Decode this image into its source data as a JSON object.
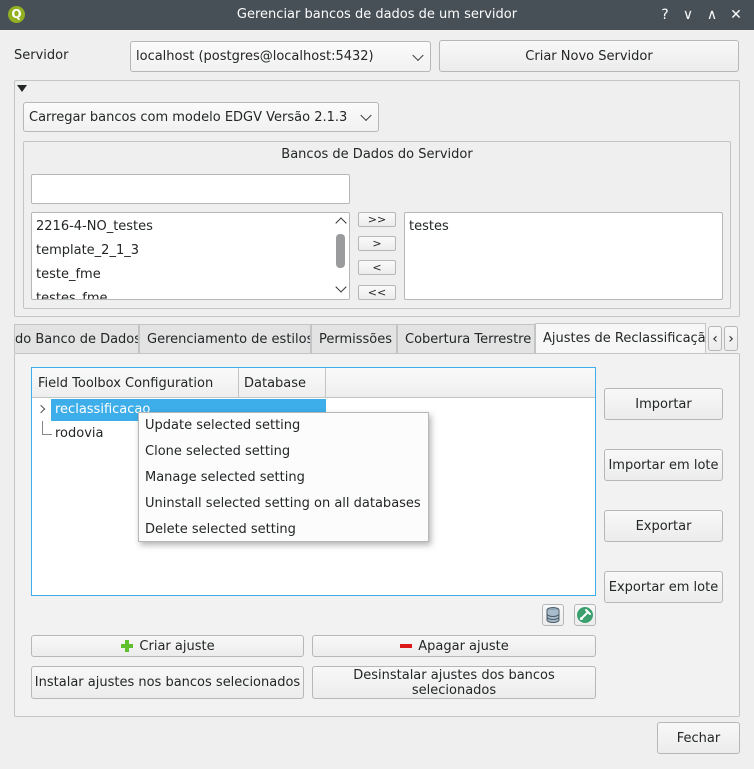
{
  "window": {
    "title": "Gerenciar bancos de dados de um servidor",
    "help_label": "?",
    "min_label": "∨",
    "max_label": "∧",
    "close_label": "✕"
  },
  "server": {
    "label": "Servidor",
    "selected": "localhost (postgres@localhost:5432)",
    "new_server_label": "Criar Novo Servidor"
  },
  "load_combo": {
    "selected": "Carregar bancos com modelo EDGV Versão 2.1.3"
  },
  "databases": {
    "title": "Bancos de Dados do Servidor",
    "filter_value": "",
    "available": [
      "2216-4-NO_testes",
      "template_2_1_3",
      "teste_fme",
      "testes_fme"
    ],
    "selected": [
      "testes"
    ],
    "move_all_right": ">>",
    "move_right": ">",
    "move_left": "<",
    "move_all_left": "<<"
  },
  "tabs": [
    {
      "label": "do Banco de Dados",
      "active": false
    },
    {
      "label": "Gerenciamento de estilos",
      "active": false
    },
    {
      "label": "Permissões",
      "active": false
    },
    {
      "label": "Cobertura Terrestre",
      "active": false
    },
    {
      "label": "Ajustes de Reclassificação",
      "active": true
    }
  ],
  "tab_scroll": {
    "left": "‹",
    "right": "›"
  },
  "tree": {
    "headers": [
      "Field Toolbox Configuration",
      "Database"
    ],
    "items": [
      "reclassificacao",
      "rodovia"
    ]
  },
  "context_menu": [
    "Update selected setting",
    "Clone selected setting",
    "Manage selected setting",
    "Uninstall selected setting on all databases",
    "Delete selected setting"
  ],
  "side_buttons": {
    "import": "Importar",
    "import_batch": "Importar em lote",
    "export": "Exportar",
    "export_batch": "Exportar em lote"
  },
  "actions": {
    "create": "Criar ajuste",
    "delete": "Apagar ajuste",
    "install": "Instalar ajustes nos bancos selecionados",
    "uninstall": "Desinstalar ajustes dos bancos selecionados",
    "close": "Fechar"
  },
  "colors": {
    "titlebar": "#475057",
    "selection": "#3daee9",
    "accent_green": "#5fbf2f",
    "accent_red": "#da1a1a"
  }
}
